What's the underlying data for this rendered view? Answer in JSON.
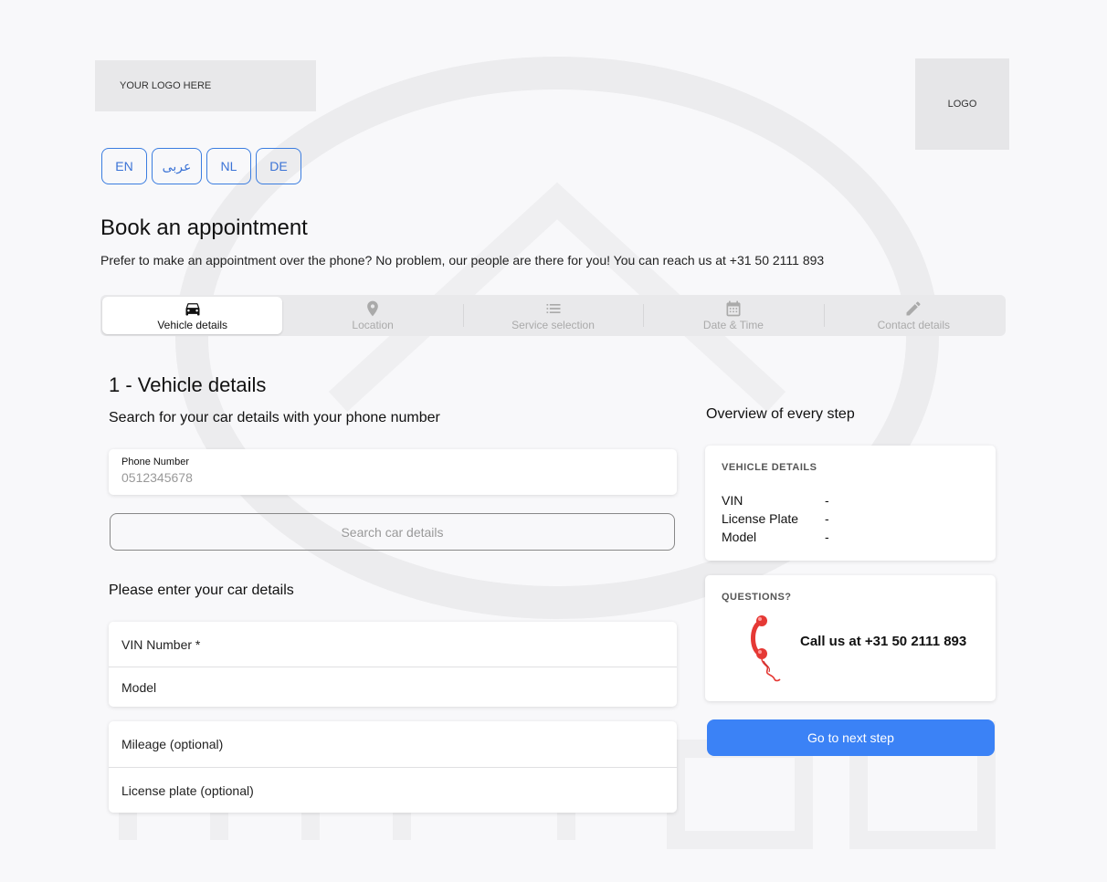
{
  "branding": {
    "logo_left_text": "YOUR LOGO HERE",
    "logo_right_text": "LOGO"
  },
  "languages": [
    "EN",
    "عربى",
    "NL",
    "DE"
  ],
  "header": {
    "title": "Book an appointment",
    "intro": "Prefer to make an appointment over the phone? No problem, our people are there for you! You can reach us at +31 50 2111 893"
  },
  "steps": [
    {
      "label": "Vehicle details",
      "icon": "car-icon",
      "active": true
    },
    {
      "label": "Location",
      "icon": "location-pin-icon",
      "active": false
    },
    {
      "label": "Service selection",
      "icon": "list-icon",
      "active": false
    },
    {
      "label": "Date & Time",
      "icon": "calendar-icon",
      "active": false
    },
    {
      "label": "Contact details",
      "icon": "pencil-icon",
      "active": false
    }
  ],
  "main": {
    "section_title": "1 - Vehicle details",
    "search_prompt": "Search for your car details with your phone number",
    "phone_label": "Phone Number",
    "phone_placeholder": "0512345678",
    "search_button": "Search car details",
    "manual_prompt": "Please enter your car details",
    "fields_group_1": [
      "VIN Number *",
      "Model"
    ],
    "fields_group_2": [
      "Mileage (optional)",
      "License plate (optional)"
    ]
  },
  "sidebar": {
    "overview_title": "Overview of every step",
    "vehicle_card": {
      "heading": "VEHICLE DETAILS",
      "rows": [
        {
          "key": "VIN",
          "value": "-"
        },
        {
          "key": "License Plate",
          "value": "-"
        },
        {
          "key": "Model",
          "value": "-"
        }
      ]
    },
    "questions_card": {
      "heading": "QUESTIONS?",
      "call_text": "Call us at +31 50 2111 893",
      "icon": "red-telephone-icon"
    },
    "next_button": "Go to next step"
  },
  "colors": {
    "accent": "#3b82f6",
    "lang_border": "#3b7de0",
    "background": "#f8f8fa",
    "phone_red": "#e53935"
  }
}
